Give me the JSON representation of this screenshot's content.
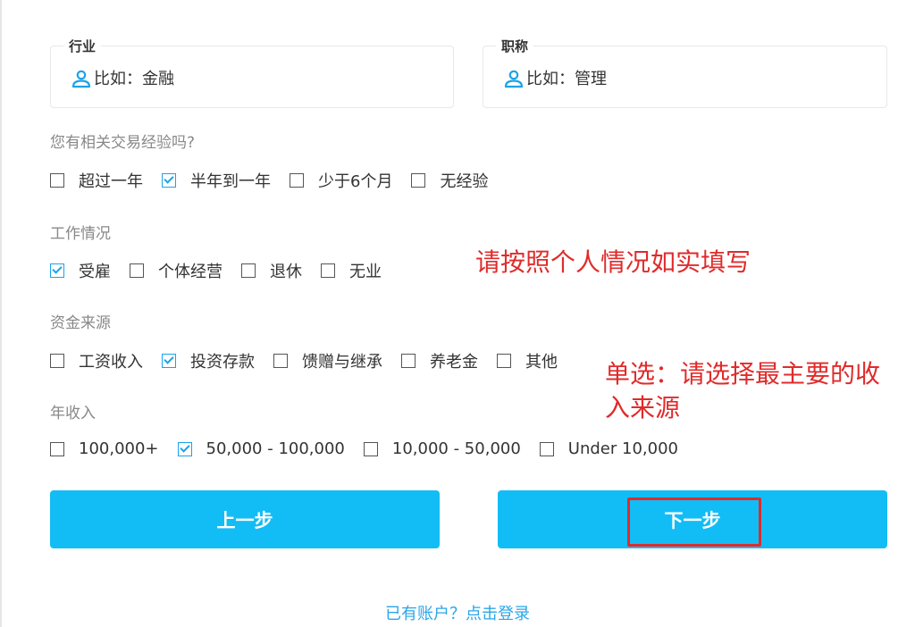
{
  "fields": {
    "industry": {
      "legend": "行业",
      "placeholder": "比如：金融",
      "icon": "user-icon"
    },
    "title": {
      "legend": "职称",
      "placeholder": "比如：管理",
      "icon": "user-icon"
    }
  },
  "experience": {
    "label": "您有相关交易经验吗?",
    "options": [
      {
        "label": "超过一年",
        "checked": false
      },
      {
        "label": "半年到一年",
        "checked": true
      },
      {
        "label": "少于6个月",
        "checked": false
      },
      {
        "label": "无经验",
        "checked": false
      }
    ]
  },
  "employment": {
    "label": "工作情况",
    "options": [
      {
        "label": "受雇",
        "checked": true
      },
      {
        "label": "个体经营",
        "checked": false
      },
      {
        "label": "退休",
        "checked": false
      },
      {
        "label": "无业",
        "checked": false
      }
    ]
  },
  "funds": {
    "label": "资金来源",
    "options": [
      {
        "label": "工资收入",
        "checked": false
      },
      {
        "label": "投资存款",
        "checked": true
      },
      {
        "label": "馈赠与继承",
        "checked": false
      },
      {
        "label": "养老金",
        "checked": false
      },
      {
        "label": "其他",
        "checked": false
      }
    ]
  },
  "income": {
    "label": "年收入",
    "options": [
      {
        "label": "100,000+",
        "checked": false
      },
      {
        "label": "50,000 - 100,000",
        "checked": true
      },
      {
        "label": "10,000 - 50,000",
        "checked": false
      },
      {
        "label": "Under 10,000",
        "checked": false
      }
    ]
  },
  "buttons": {
    "prev": "上一步",
    "next": "下一步"
  },
  "annotations": {
    "fill_truthfully": "请按照个人情况如实填写",
    "single_choice_line1": "单选：请选择最主要的收",
    "single_choice_line2": "入来源"
  },
  "login_link": "已有账户？点击登录",
  "colors": {
    "accent": "#12bdf6",
    "check": "#1aa3e8",
    "annotation": "#e02b2b",
    "link": "#2aa6e8"
  }
}
